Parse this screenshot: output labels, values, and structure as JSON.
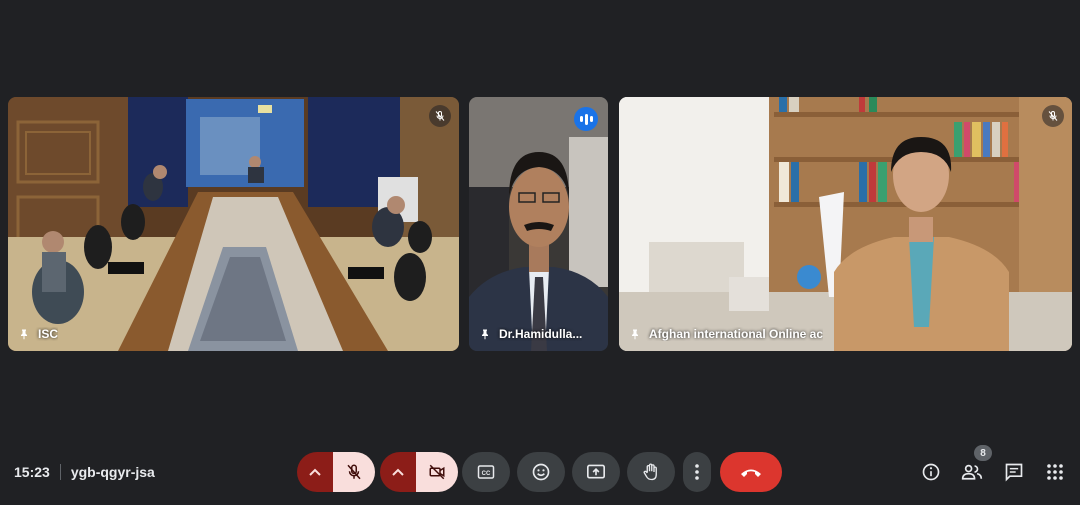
{
  "tiles": [
    {
      "name": "ISC",
      "muted": true
    },
    {
      "name": "Dr.Hamidulla...",
      "speaking": true
    },
    {
      "name": "Afghan international Online ac",
      "muted": true
    }
  ],
  "meeting": {
    "time": "15:23",
    "code": "ygb-qgyr-jsa"
  },
  "participants_count": "8",
  "controls": {
    "mic": "off",
    "camera": "off",
    "icons": [
      "caret-up-icon",
      "mic-off-icon",
      "camera-off-icon",
      "captions-icon",
      "emoji-icon",
      "present-icon",
      "raise-hand-icon",
      "more-vert-icon",
      "call-end-icon",
      "info-icon",
      "people-icon",
      "chat-icon",
      "apps-grid-icon"
    ]
  },
  "colors": {
    "background": "#202124",
    "end_call": "#dc362e",
    "mic_off_caret": "#8c1d18",
    "mic_off_fill": "#f9dedc",
    "speaking": "#1a73e8"
  }
}
